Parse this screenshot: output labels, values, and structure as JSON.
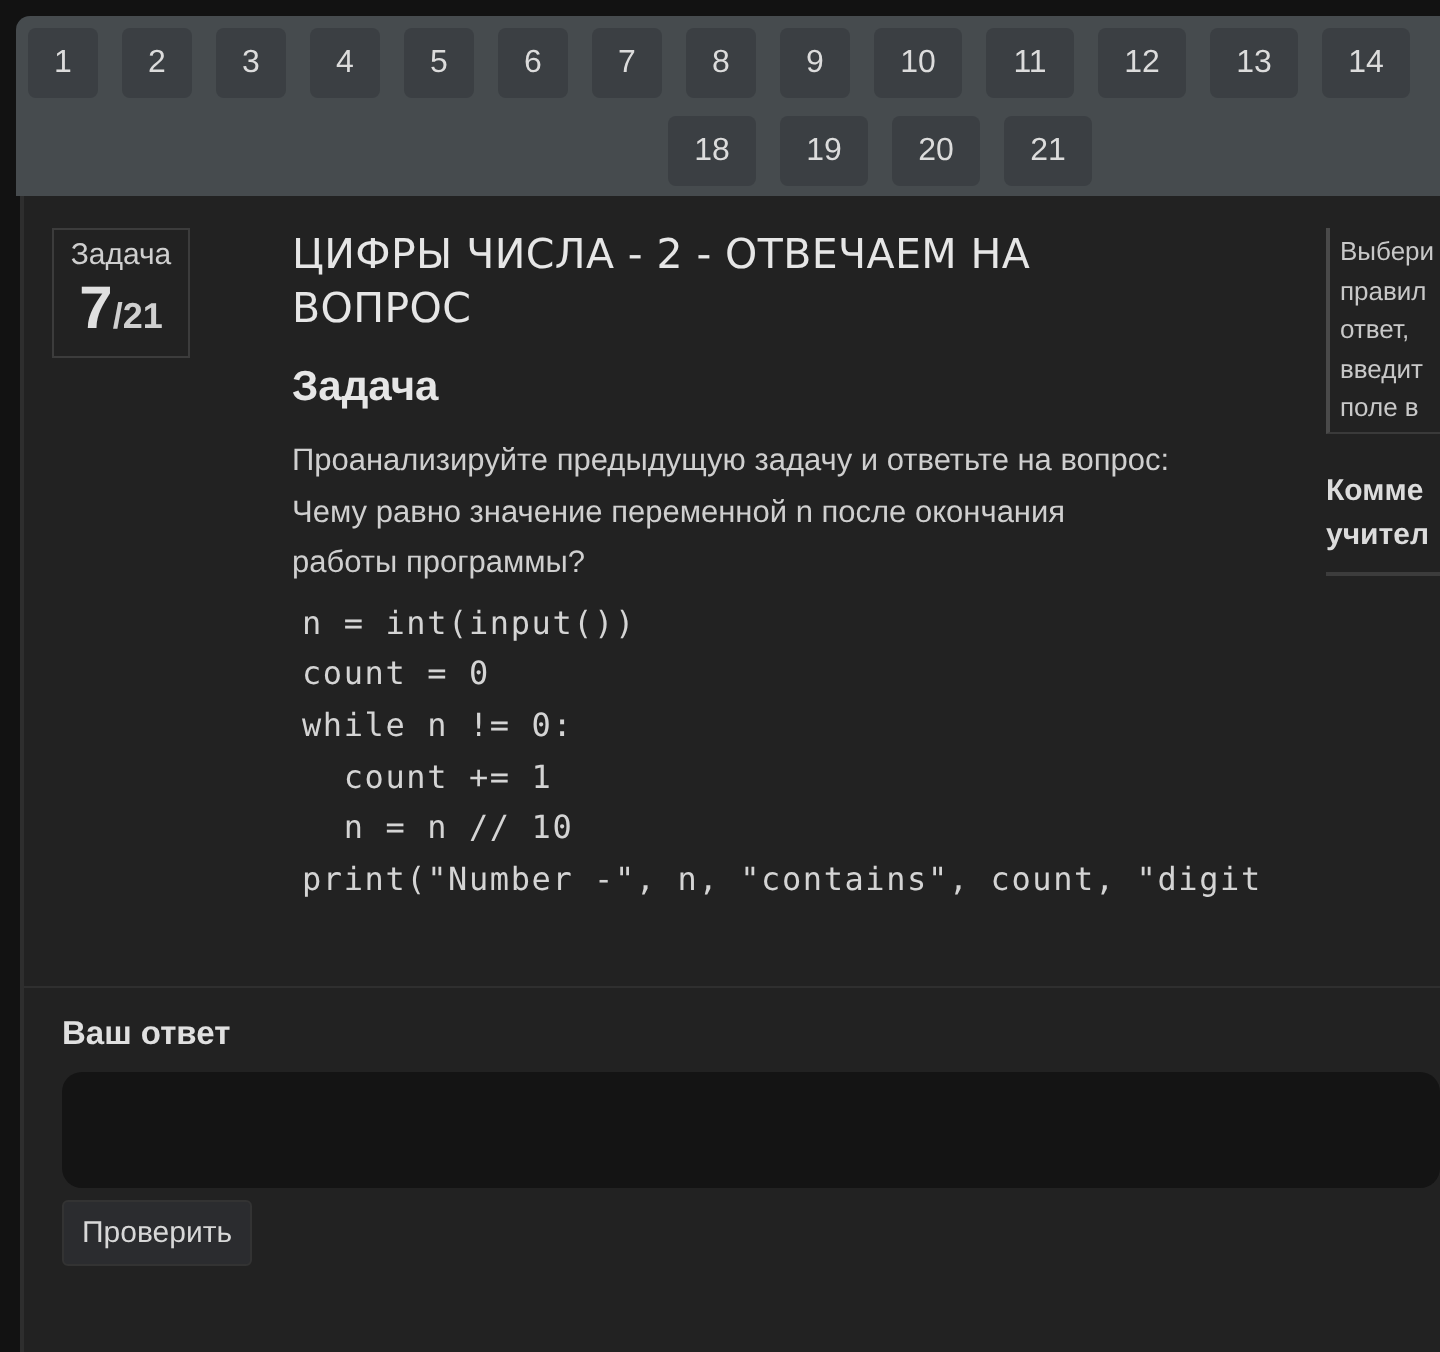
{
  "task_nav": {
    "first_row": [
      {
        "label": "1"
      },
      {
        "label": "2"
      },
      {
        "label": "3"
      },
      {
        "label": "4"
      },
      {
        "label": "5"
      },
      {
        "label": "6"
      },
      {
        "label": "7"
      },
      {
        "label": "8"
      },
      {
        "label": "9"
      },
      {
        "label": "10"
      },
      {
        "label": "11"
      },
      {
        "label": "12"
      },
      {
        "label": "13"
      },
      {
        "label": "14"
      }
    ],
    "second_row": [
      {
        "label": "18"
      },
      {
        "label": "19"
      },
      {
        "label": "20"
      },
      {
        "label": "21"
      }
    ]
  },
  "task_badge": {
    "label": "Задача",
    "number": "7",
    "total": "/21"
  },
  "title": "ЦИФРЫ ЧИСЛА - 2 - ОТВЕЧАЕМ НА ВОПРОС",
  "section_heading": "Задача",
  "paragraphs": [
    "Проанализируйте предыдущую задачу и ответьте на вопрос:",
    "Чему равно значение переменной n после окончания работы программы?"
  ],
  "code": [
    "n = int(input())",
    "count = 0",
    "while n != 0:",
    "  count += 1",
    "  n = n // 10",
    "print(\"Number -\", n, \"contains\", count, \"digit"
  ],
  "hint_lines": [
    "Выбери",
    "правил",
    "ответ,",
    "введит",
    "поле в"
  ],
  "comments_heading": [
    "Комме",
    "учител"
  ],
  "answer": {
    "label": "Ваш ответ",
    "button": "Проверить"
  }
}
